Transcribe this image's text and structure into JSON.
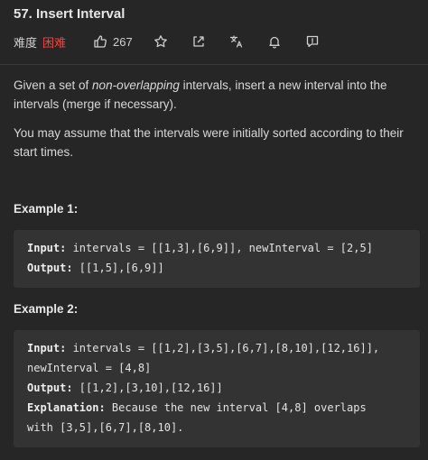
{
  "problem": {
    "title": "57. Insert Interval",
    "difficulty_label": "难度",
    "difficulty_value": "困难",
    "likes": "267"
  },
  "icons": [
    "like-icon",
    "star-icon",
    "share-icon",
    "translate-icon",
    "bell-icon",
    "feedback-icon"
  ],
  "colors": {
    "background": "#262626",
    "code_background": "#333333",
    "difficulty_hard": "#ef4743"
  },
  "description": {
    "p1_before": "Given a set of ",
    "p1_em": "non-overlapping",
    "p1_after": " intervals, insert a new interval into the intervals (merge if necessary).",
    "p2": "You may assume that the intervals were initially sorted according to their start times."
  },
  "examples": [
    {
      "heading": "Example 1:",
      "input_label": "Input:",
      "input_line1": " intervals = [[1,3],[6,9]], newInterval = [2,5]",
      "output_label": "Output:",
      "output_value": " [[1,5],[6,9]]"
    },
    {
      "heading": "Example 2:",
      "input_label": "Input:",
      "input_line1": " intervals = [[1,2],[3,5],[6,7],[8,10],[12,16]],",
      "input_line2": "newInterval = [4,8]",
      "output_label": "Output:",
      "output_value": " [[1,2],[3,10],[12,16]]",
      "explanation_label": "Explanation:",
      "explanation_line1": " Because the new interval [4,8] overlaps",
      "explanation_line2": "with [3,5],[6,7],[8,10]."
    }
  ]
}
